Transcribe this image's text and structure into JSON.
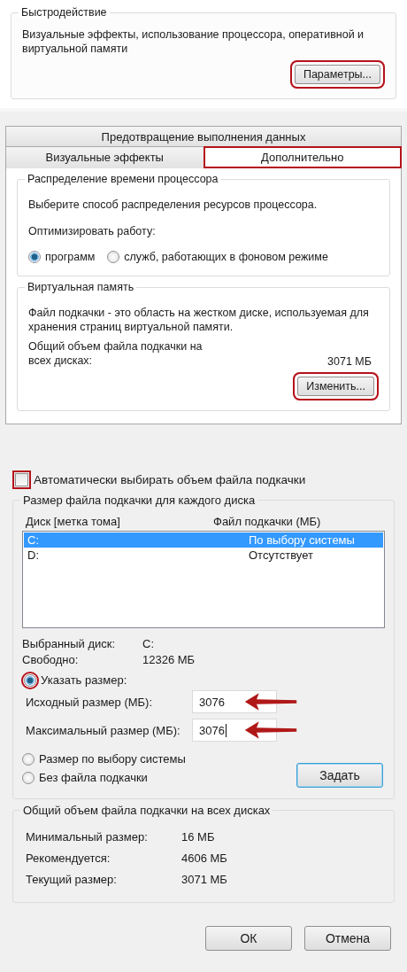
{
  "performance_panel": {
    "group_title": "Быстродействие",
    "description": "Визуальные эффекты, использование процессора, оперативной и виртуальной памяти",
    "button": {
      "label": "Параметры...",
      "highlighted": true
    }
  },
  "performance_options": {
    "tab_rows": [
      [
        {
          "label": "Предотвращение выполнения данных",
          "selected": false,
          "highlighted": false
        }
      ],
      [
        {
          "label": "Визуальные эффекты",
          "selected": false,
          "highlighted": false
        },
        {
          "label": "Дополнительно",
          "selected": true,
          "highlighted": true
        }
      ]
    ],
    "processor_group": {
      "title": "Распределение времени процессора",
      "description": "Выберите способ распределения ресурсов процессора.",
      "optimize_label": "Оптимизировать работу:",
      "options": [
        {
          "label": "программ",
          "selected": true
        },
        {
          "label": "служб, работающих в фоновом режиме",
          "selected": false
        }
      ]
    },
    "virtual_memory_group": {
      "title": "Виртуальная память",
      "description": "Файл подкачки - это область на жестком диске, используемая для хранения страниц виртуальной памяти.",
      "total_label": "Общий объем файла подкачки на всех дисках:",
      "total_value": "3071 МБ",
      "button": {
        "label": "Изменить...",
        "highlighted": true
      }
    }
  },
  "virtual_memory_dialog": {
    "auto_checkbox": {
      "label": "Автоматически выбирать объем файла подкачки",
      "checked": false,
      "highlighted": true
    },
    "per_disk_group": {
      "title": "Размер файла подкачки для каждого диска",
      "columns": [
        "Диск [метка тома]",
        "Файл подкачки (МБ)"
      ],
      "rows": [
        {
          "disk": "C:",
          "paging_file": "По выбору системы",
          "selected": true
        },
        {
          "disk": "D:",
          "paging_file": "Отсутствует",
          "selected": false
        }
      ],
      "info": [
        {
          "label": "Выбранный диск:",
          "value": "C:"
        },
        {
          "label": "Свободно:",
          "value": "12326 МБ"
        }
      ],
      "size_options": [
        {
          "label": "Указать размер:",
          "selected": true,
          "highlighted": true
        },
        {
          "label": "Размер по выбору системы",
          "selected": false,
          "highlighted": false
        },
        {
          "label": "Без файла подкачки",
          "selected": false,
          "highlighted": false
        }
      ],
      "fields": [
        {
          "label": "Исходный размер (МБ):",
          "value": "3076",
          "arrow": true,
          "cursor": false
        },
        {
          "label": "Максимальный размер (МБ):",
          "value": "3076",
          "arrow": true,
          "cursor": true
        }
      ],
      "set_button": "Задать"
    },
    "totals_group": {
      "title": "Общий объем файла подкачки на всех дисках",
      "rows": [
        {
          "label": "Минимальный размер:",
          "value": "16 МБ"
        },
        {
          "label": "Рекомендуется:",
          "value": "4606 МБ"
        },
        {
          "label": "Текущий размер:",
          "value": "3071 МБ"
        }
      ]
    },
    "buttons": [
      "ОК",
      "Отмена"
    ]
  }
}
